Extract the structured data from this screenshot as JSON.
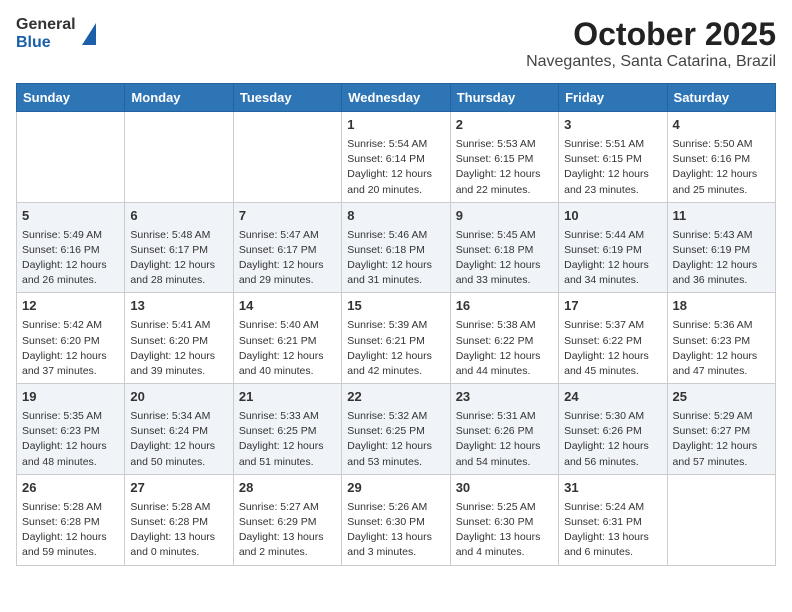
{
  "header": {
    "logo_general": "General",
    "logo_blue": "Blue",
    "month_year": "October 2025",
    "location": "Navegantes, Santa Catarina, Brazil"
  },
  "weekdays": [
    "Sunday",
    "Monday",
    "Tuesday",
    "Wednesday",
    "Thursday",
    "Friday",
    "Saturday"
  ],
  "weeks": [
    [
      {
        "day": "",
        "sunrise": "",
        "sunset": "",
        "daylight": ""
      },
      {
        "day": "",
        "sunrise": "",
        "sunset": "",
        "daylight": ""
      },
      {
        "day": "",
        "sunrise": "",
        "sunset": "",
        "daylight": ""
      },
      {
        "day": "1",
        "sunrise": "Sunrise: 5:54 AM",
        "sunset": "Sunset: 6:14 PM",
        "daylight": "Daylight: 12 hours and 20 minutes."
      },
      {
        "day": "2",
        "sunrise": "Sunrise: 5:53 AM",
        "sunset": "Sunset: 6:15 PM",
        "daylight": "Daylight: 12 hours and 22 minutes."
      },
      {
        "day": "3",
        "sunrise": "Sunrise: 5:51 AM",
        "sunset": "Sunset: 6:15 PM",
        "daylight": "Daylight: 12 hours and 23 minutes."
      },
      {
        "day": "4",
        "sunrise": "Sunrise: 5:50 AM",
        "sunset": "Sunset: 6:16 PM",
        "daylight": "Daylight: 12 hours and 25 minutes."
      }
    ],
    [
      {
        "day": "5",
        "sunrise": "Sunrise: 5:49 AM",
        "sunset": "Sunset: 6:16 PM",
        "daylight": "Daylight: 12 hours and 26 minutes."
      },
      {
        "day": "6",
        "sunrise": "Sunrise: 5:48 AM",
        "sunset": "Sunset: 6:17 PM",
        "daylight": "Daylight: 12 hours and 28 minutes."
      },
      {
        "day": "7",
        "sunrise": "Sunrise: 5:47 AM",
        "sunset": "Sunset: 6:17 PM",
        "daylight": "Daylight: 12 hours and 29 minutes."
      },
      {
        "day": "8",
        "sunrise": "Sunrise: 5:46 AM",
        "sunset": "Sunset: 6:18 PM",
        "daylight": "Daylight: 12 hours and 31 minutes."
      },
      {
        "day": "9",
        "sunrise": "Sunrise: 5:45 AM",
        "sunset": "Sunset: 6:18 PM",
        "daylight": "Daylight: 12 hours and 33 minutes."
      },
      {
        "day": "10",
        "sunrise": "Sunrise: 5:44 AM",
        "sunset": "Sunset: 6:19 PM",
        "daylight": "Daylight: 12 hours and 34 minutes."
      },
      {
        "day": "11",
        "sunrise": "Sunrise: 5:43 AM",
        "sunset": "Sunset: 6:19 PM",
        "daylight": "Daylight: 12 hours and 36 minutes."
      }
    ],
    [
      {
        "day": "12",
        "sunrise": "Sunrise: 5:42 AM",
        "sunset": "Sunset: 6:20 PM",
        "daylight": "Daylight: 12 hours and 37 minutes."
      },
      {
        "day": "13",
        "sunrise": "Sunrise: 5:41 AM",
        "sunset": "Sunset: 6:20 PM",
        "daylight": "Daylight: 12 hours and 39 minutes."
      },
      {
        "day": "14",
        "sunrise": "Sunrise: 5:40 AM",
        "sunset": "Sunset: 6:21 PM",
        "daylight": "Daylight: 12 hours and 40 minutes."
      },
      {
        "day": "15",
        "sunrise": "Sunrise: 5:39 AM",
        "sunset": "Sunset: 6:21 PM",
        "daylight": "Daylight: 12 hours and 42 minutes."
      },
      {
        "day": "16",
        "sunrise": "Sunrise: 5:38 AM",
        "sunset": "Sunset: 6:22 PM",
        "daylight": "Daylight: 12 hours and 44 minutes."
      },
      {
        "day": "17",
        "sunrise": "Sunrise: 5:37 AM",
        "sunset": "Sunset: 6:22 PM",
        "daylight": "Daylight: 12 hours and 45 minutes."
      },
      {
        "day": "18",
        "sunrise": "Sunrise: 5:36 AM",
        "sunset": "Sunset: 6:23 PM",
        "daylight": "Daylight: 12 hours and 47 minutes."
      }
    ],
    [
      {
        "day": "19",
        "sunrise": "Sunrise: 5:35 AM",
        "sunset": "Sunset: 6:23 PM",
        "daylight": "Daylight: 12 hours and 48 minutes."
      },
      {
        "day": "20",
        "sunrise": "Sunrise: 5:34 AM",
        "sunset": "Sunset: 6:24 PM",
        "daylight": "Daylight: 12 hours and 50 minutes."
      },
      {
        "day": "21",
        "sunrise": "Sunrise: 5:33 AM",
        "sunset": "Sunset: 6:25 PM",
        "daylight": "Daylight: 12 hours and 51 minutes."
      },
      {
        "day": "22",
        "sunrise": "Sunrise: 5:32 AM",
        "sunset": "Sunset: 6:25 PM",
        "daylight": "Daylight: 12 hours and 53 minutes."
      },
      {
        "day": "23",
        "sunrise": "Sunrise: 5:31 AM",
        "sunset": "Sunset: 6:26 PM",
        "daylight": "Daylight: 12 hours and 54 minutes."
      },
      {
        "day": "24",
        "sunrise": "Sunrise: 5:30 AM",
        "sunset": "Sunset: 6:26 PM",
        "daylight": "Daylight: 12 hours and 56 minutes."
      },
      {
        "day": "25",
        "sunrise": "Sunrise: 5:29 AM",
        "sunset": "Sunset: 6:27 PM",
        "daylight": "Daylight: 12 hours and 57 minutes."
      }
    ],
    [
      {
        "day": "26",
        "sunrise": "Sunrise: 5:28 AM",
        "sunset": "Sunset: 6:28 PM",
        "daylight": "Daylight: 12 hours and 59 minutes."
      },
      {
        "day": "27",
        "sunrise": "Sunrise: 5:28 AM",
        "sunset": "Sunset: 6:28 PM",
        "daylight": "Daylight: 13 hours and 0 minutes."
      },
      {
        "day": "28",
        "sunrise": "Sunrise: 5:27 AM",
        "sunset": "Sunset: 6:29 PM",
        "daylight": "Daylight: 13 hours and 2 minutes."
      },
      {
        "day": "29",
        "sunrise": "Sunrise: 5:26 AM",
        "sunset": "Sunset: 6:30 PM",
        "daylight": "Daylight: 13 hours and 3 minutes."
      },
      {
        "day": "30",
        "sunrise": "Sunrise: 5:25 AM",
        "sunset": "Sunset: 6:30 PM",
        "daylight": "Daylight: 13 hours and 4 minutes."
      },
      {
        "day": "31",
        "sunrise": "Sunrise: 5:24 AM",
        "sunset": "Sunset: 6:31 PM",
        "daylight": "Daylight: 13 hours and 6 minutes."
      },
      {
        "day": "",
        "sunrise": "",
        "sunset": "",
        "daylight": ""
      }
    ]
  ]
}
